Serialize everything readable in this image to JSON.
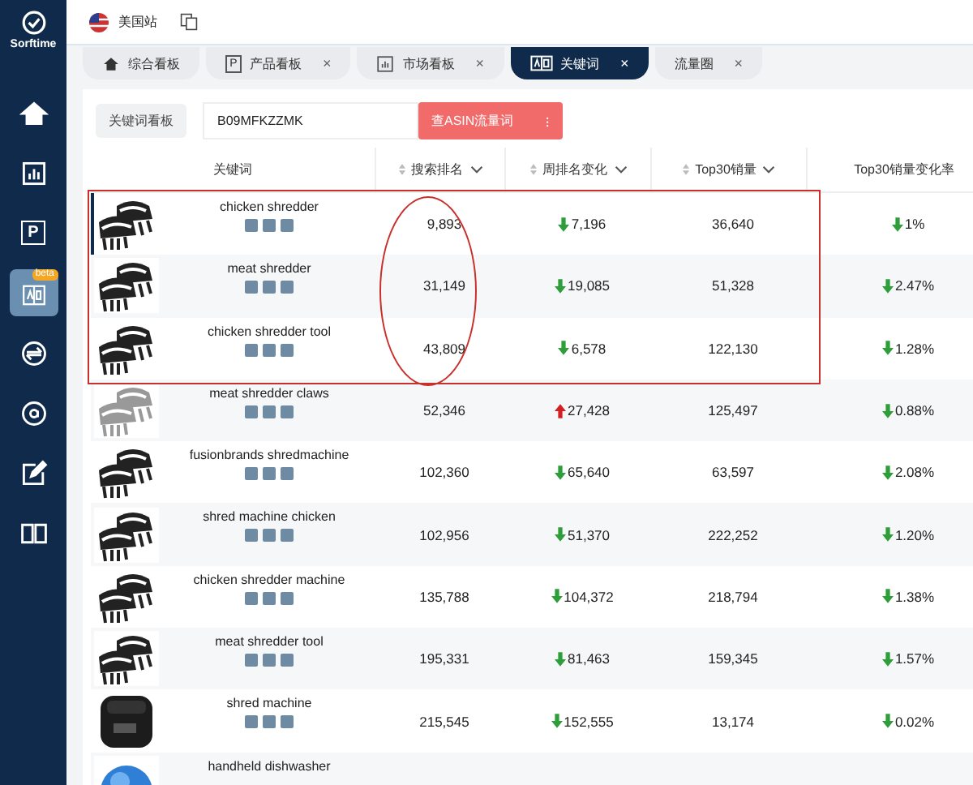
{
  "sidebar": {
    "brand": "Sorftime",
    "items": [
      {
        "kind": "home",
        "selected": false
      },
      {
        "kind": "chart",
        "selected": false
      },
      {
        "kind": "letter",
        "glyph": "P",
        "selected": false
      },
      {
        "kind": "keyword",
        "badge": "beta",
        "selected": true
      },
      {
        "kind": "swap",
        "selected": false
      },
      {
        "kind": "amazon",
        "selected": false
      },
      {
        "kind": "edit",
        "selected": false
      },
      {
        "kind": "book",
        "selected": false
      }
    ]
  },
  "topbar": {
    "site": "美国站"
  },
  "tabs": [
    {
      "label": "综合看板",
      "selected": false
    },
    {
      "label": "产品看板",
      "glyph": "P",
      "close": "×",
      "selected": false
    },
    {
      "label": "市场看板",
      "close": "×",
      "selected": false
    },
    {
      "label": "关键词",
      "close": "×",
      "selected": true
    },
    {
      "label": "流量圈",
      "close": "×",
      "selected": false
    }
  ],
  "toolbar": {
    "label": "关键词看板",
    "asin": "B09MFKZZMK",
    "button": "查ASIN流量词",
    "button_icon": "⁝"
  },
  "table": {
    "columns": [
      "关键词",
      "搜索排名",
      "周排名变化",
      "Top30销量",
      "Top30销量变化率"
    ],
    "rows": [
      {
        "keyword": "chicken shredder",
        "rank": "9,893",
        "change": "7,196",
        "change_up": false,
        "sales": "36,640",
        "rate": "1%",
        "rate_up": false,
        "selected": true
      },
      {
        "keyword": "meat shredder",
        "rank": "31,149",
        "change": "19,085",
        "change_up": false,
        "sales": "51,328",
        "rate": "2.47%",
        "rate_up": false,
        "selected": false
      },
      {
        "keyword": "chicken shredder tool",
        "rank": "43,809",
        "change": "6,578",
        "change_up": false,
        "sales": "122,130",
        "rate": "1.28%",
        "rate_up": false,
        "selected": false
      },
      {
        "keyword": "meat shredder claws",
        "rank": "52,346",
        "change": "27,428",
        "change_up": true,
        "sales": "125,497",
        "rate": "0.88%",
        "rate_up": false,
        "selected": false
      },
      {
        "keyword": "fusionbrands shredmachine",
        "rank": "102,360",
        "change": "65,640",
        "change_up": false,
        "sales": "63,597",
        "rate": "2.08%",
        "rate_up": false,
        "selected": false
      },
      {
        "keyword": "shred machine chicken",
        "rank": "102,956",
        "change": "51,370",
        "change_up": false,
        "sales": "222,252",
        "rate": "1.20%",
        "rate_up": false,
        "selected": false
      },
      {
        "keyword": "chicken shredder machine",
        "rank": "135,788",
        "change": "104,372",
        "change_up": false,
        "sales": "218,794",
        "rate": "1.38%",
        "rate_up": false,
        "selected": false
      },
      {
        "keyword": "meat shredder tool",
        "rank": "195,331",
        "change": "81,463",
        "change_up": false,
        "sales": "159,345",
        "rate": "1.57%",
        "rate_up": false,
        "selected": false
      },
      {
        "keyword": "shred machine",
        "rank": "215,545",
        "change": "152,555",
        "change_up": false,
        "sales": "13,174",
        "rate": "0.02%",
        "rate_up": false,
        "selected": false
      },
      {
        "keyword": "handheld dishwasher",
        "selected": false
      }
    ]
  }
}
